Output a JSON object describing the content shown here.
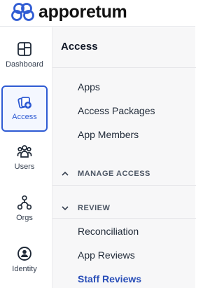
{
  "brand": {
    "name": "apporetum",
    "logo_color": "#2f5bd3"
  },
  "rail": {
    "items": [
      {
        "label": "Dashboard",
        "icon": "dashboard-icon"
      },
      {
        "label": "Access",
        "icon": "access-icon",
        "active": true
      },
      {
        "label": "Users",
        "icon": "users-icon"
      },
      {
        "label": "Orgs",
        "icon": "orgs-icon"
      },
      {
        "label": "Identity",
        "icon": "identity-icon"
      }
    ]
  },
  "panel": {
    "title": "Access",
    "links": [
      "Apps",
      "Access Packages",
      "App Members"
    ],
    "sections": [
      {
        "label": "MANAGE ACCESS",
        "expanded": false,
        "icon": "chevron-up-icon"
      },
      {
        "label": "REVIEW",
        "expanded": true,
        "icon": "chevron-down-icon",
        "items": [
          "Reconciliation",
          "App Reviews",
          "Staff Reviews"
        ],
        "active_item": "Staff Reviews"
      }
    ]
  },
  "colors": {
    "accent": "#2f5bd3",
    "active_link": "#2a4fb8",
    "panel_bg": "#f7f7f8"
  }
}
